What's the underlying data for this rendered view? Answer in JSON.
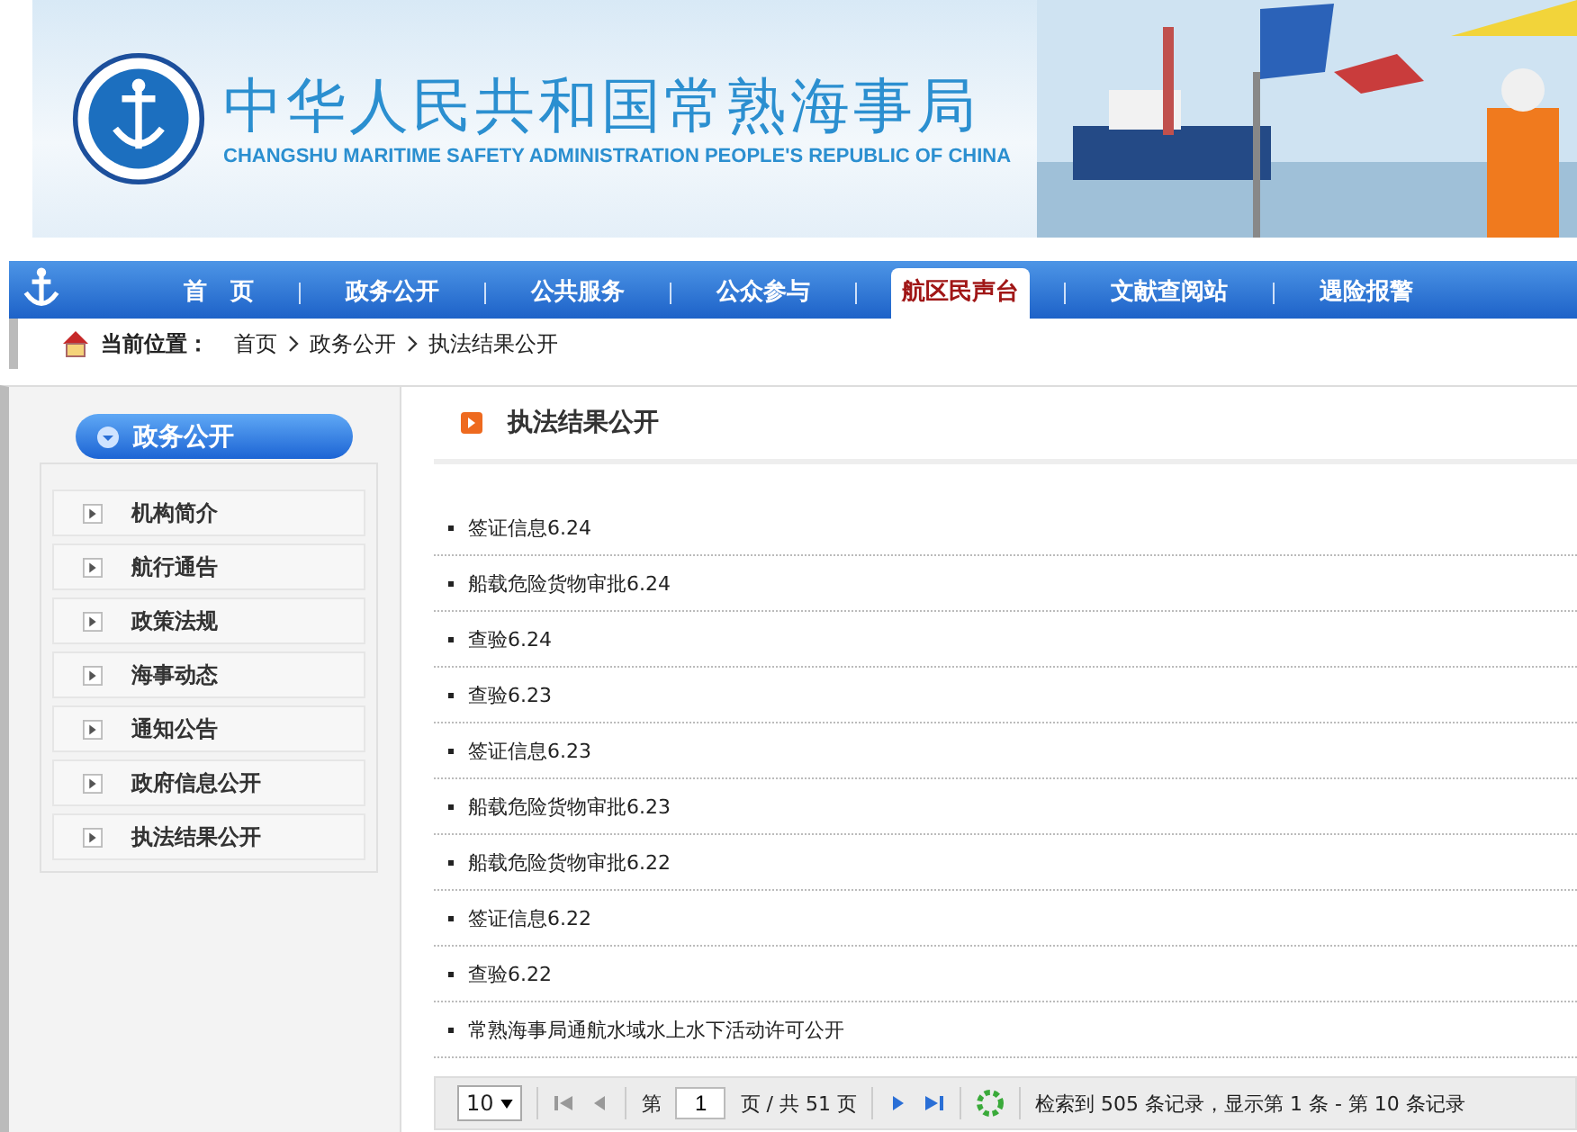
{
  "banner": {
    "title": "中华人民共和国常熟海事局",
    "subtitle": "CHANGSHU MARITIME SAFETY ADMINISTRATION PEOPLE'S REPUBLIC OF CHINA"
  },
  "nav": [
    {
      "label": "首　页",
      "selected": false
    },
    {
      "label": "政务公开",
      "selected": false
    },
    {
      "label": "公共服务",
      "selected": false
    },
    {
      "label": "公众参与",
      "selected": false
    },
    {
      "label": "航区民声台",
      "selected": true
    },
    {
      "label": "文献查阅站",
      "selected": false
    },
    {
      "label": "遇险报警",
      "selected": false
    }
  ],
  "breadcrumb": {
    "label": "当前位置：",
    "path": [
      "首页",
      "政务公开",
      "执法结果公开"
    ]
  },
  "sidebar": {
    "title": "政务公开",
    "items": [
      "机构简介",
      "航行通告",
      "政策法规",
      "海事动态",
      "通知公告",
      "政府信息公开",
      "执法结果公开"
    ]
  },
  "main": {
    "title": "执法结果公开",
    "items": [
      "签证信息6.24",
      "船载危险货物审批6.24",
      "查验6.24",
      "查验6.23",
      "签证信息6.23",
      "船载危险货物审批6.23",
      "船载危险货物审批6.22",
      "签证信息6.22",
      "查验6.22",
      "常熟海事局通航水域水上水下活动许可公开"
    ]
  },
  "pager": {
    "page_size": "10",
    "page_label": "第",
    "page": "1",
    "total_label": "页 / 共 51 页",
    "first_disabled": true,
    "prev_disabled": true,
    "summary": "检索到 505 条记录，显示第 1 条 - 第 10 条记录"
  }
}
